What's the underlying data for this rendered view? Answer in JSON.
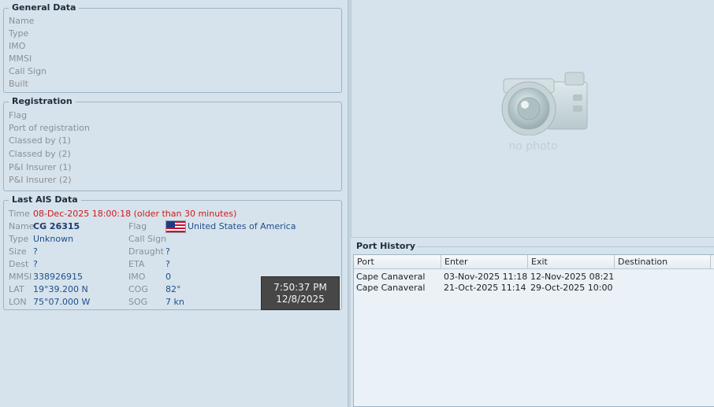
{
  "general": {
    "title": "General Data",
    "fields": [
      "Name",
      "Type",
      "IMO",
      "MMSI",
      "Call Sign",
      "Built"
    ]
  },
  "registration": {
    "title": "Registration",
    "fields": [
      "Flag",
      "Port of registration",
      "Classed by (1)",
      "Classed by (2)",
      "P&I Insurer (1)",
      "P&I Insurer (2)"
    ]
  },
  "ais": {
    "title": "Last AIS Data",
    "time_label": "Time",
    "time_value": "08-Dec-2025 18:00:18 (older than 30 minutes)",
    "name_label": "Name",
    "name_value": "CG 26315",
    "flag_label": "Flag",
    "flag_value": "United States of America",
    "type_label": "Type",
    "type_value": "Unknown",
    "callsign_label": "Call Sign",
    "callsign_value": "",
    "size_label": "Size",
    "size_value": "?",
    "draught_label": "Draught",
    "draught_value": "?",
    "dest_label": "Dest",
    "dest_value": "?",
    "eta_label": "ETA",
    "eta_value": "?",
    "mmsi_label": "MMSI",
    "mmsi_value": "338926915",
    "imo_label": "IMO",
    "imo_value": "0",
    "lat_label": "LAT",
    "lat_value": "19°39.200 N",
    "cog_label": "COG",
    "cog_value": "82°",
    "lon_label": "LON",
    "lon_value": "75°07.000 W",
    "sog_label": "SOG",
    "sog_value": "7 kn"
  },
  "tooltip": {
    "time": "7:50:37 PM",
    "date": "12/8/2025"
  },
  "photo": {
    "placeholder": "no photo",
    "icon": "camera-icon"
  },
  "port_history": {
    "title": "Port History",
    "columns": [
      "Port",
      "Enter",
      "Exit",
      "Destination"
    ],
    "rows": [
      [
        "Cape Canaveral",
        "03-Nov-2025 11:18",
        "12-Nov-2025 08:21",
        ""
      ],
      [
        "Cape Canaveral",
        "21-Oct-2025 11:14",
        "29-Oct-2025 10:00",
        ""
      ]
    ]
  },
  "colors": {
    "background": "#d6e3ec",
    "value_text": "#1f4e8c",
    "warning_text": "#d11818"
  }
}
